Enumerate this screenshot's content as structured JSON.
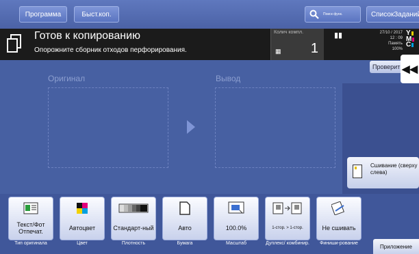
{
  "topbar": {
    "program_label": "Программа",
    "quick_label": "Быст.коп.",
    "search_label": "Поиск функ.",
    "list_label": "СписокЗаданий"
  },
  "status": {
    "title": "Готов к копированию",
    "message": "Опорожните сборник отходов перфорирования.",
    "count_label": "Колич компл.",
    "count_value": "1",
    "date": "27/10 / 2017",
    "time": "12 : 09",
    "memory_label": "Память",
    "memory_value": "100%",
    "toner_letters": [
      "Y",
      "M",
      "C",
      "K"
    ],
    "toner_colors": [
      "#f2d100",
      "#e2007a",
      "#00a0e0",
      "#222222"
    ]
  },
  "main": {
    "check_label": "Проверить",
    "original_label": "Оригинал",
    "output_label": "Вывод",
    "staple_label": "Сшивание (сверху слева)"
  },
  "functions": [
    {
      "name": "original-type",
      "value": "Текст/Фот Отпечат.",
      "caption": "Тип оригинала",
      "icon": "text-photo-icon"
    },
    {
      "name": "color",
      "value": "Автоцвет",
      "caption": "Цвет",
      "icon": "auto-color-icon"
    },
    {
      "name": "density",
      "value": "Стандарт-ный",
      "caption": "Плотность",
      "icon": "density-icon"
    },
    {
      "name": "paper",
      "value": "Авто",
      "caption": "Бумага",
      "icon": "paper-icon"
    },
    {
      "name": "zoom",
      "value": "100.0%",
      "caption": "Масштаб",
      "icon": "zoom-icon"
    },
    {
      "name": "duplex",
      "value": "1-стор. > 1-стор.",
      "caption": "Дуплекс/ комбинир.",
      "icon": "duplex-icon"
    },
    {
      "name": "finishing",
      "value": "Не сшивать",
      "caption": "Финиши-рование",
      "icon": "finishing-icon"
    }
  ],
  "apps_label": "Приложение"
}
